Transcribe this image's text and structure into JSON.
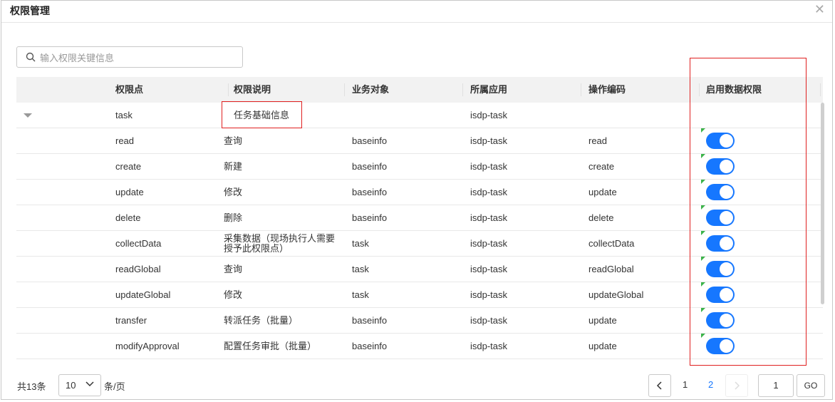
{
  "dialog": {
    "title": "权限管理",
    "close_icon": "close-icon"
  },
  "search": {
    "placeholder": "输入权限关键信息",
    "value": ""
  },
  "table": {
    "headers": [
      "权限点",
      "权限说明",
      "业务对象",
      "所属应用",
      "操作编码",
      "启用数据权限"
    ],
    "group": {
      "name": "task",
      "desc": "任务基础信息",
      "object": "",
      "app": "isdp-task",
      "code": ""
    },
    "rows": [
      {
        "point": "read",
        "desc": "查询",
        "object": "baseinfo",
        "app": "isdp-task",
        "code": "read",
        "enabled": true
      },
      {
        "point": "create",
        "desc": "新建",
        "object": "baseinfo",
        "app": "isdp-task",
        "code": "create",
        "enabled": true
      },
      {
        "point": "update",
        "desc": "修改",
        "object": "baseinfo",
        "app": "isdp-task",
        "code": "update",
        "enabled": true
      },
      {
        "point": "delete",
        "desc": "删除",
        "object": "baseinfo",
        "app": "isdp-task",
        "code": "delete",
        "enabled": true
      },
      {
        "point": "collectData",
        "desc": "采集数据（现场执行人需要授予此权限点）",
        "object": "task",
        "app": "isdp-task",
        "code": "collectData",
        "enabled": true
      },
      {
        "point": "readGlobal",
        "desc": "查询",
        "object": "task",
        "app": "isdp-task",
        "code": "readGlobal",
        "enabled": true
      },
      {
        "point": "updateGlobal",
        "desc": "修改",
        "object": "task",
        "app": "isdp-task",
        "code": "updateGlobal",
        "enabled": true
      },
      {
        "point": "transfer",
        "desc": "转派任务（批量）",
        "object": "baseinfo",
        "app": "isdp-task",
        "code": "update",
        "enabled": true
      },
      {
        "point": "modifyApproval",
        "desc": "配置任务审批（批量）",
        "object": "baseinfo",
        "app": "isdp-task",
        "code": "update",
        "enabled": true
      }
    ]
  },
  "pagination": {
    "total_label": "共13条",
    "page_size": "10",
    "per_page_label": "条/页",
    "pages": [
      "1",
      "2"
    ],
    "current_page": "2",
    "jump_value": "1",
    "go_label": "GO"
  },
  "colors": {
    "toggle_on": "#1677ff",
    "highlight_box": "#e02020",
    "active_page": "#1677ff"
  }
}
